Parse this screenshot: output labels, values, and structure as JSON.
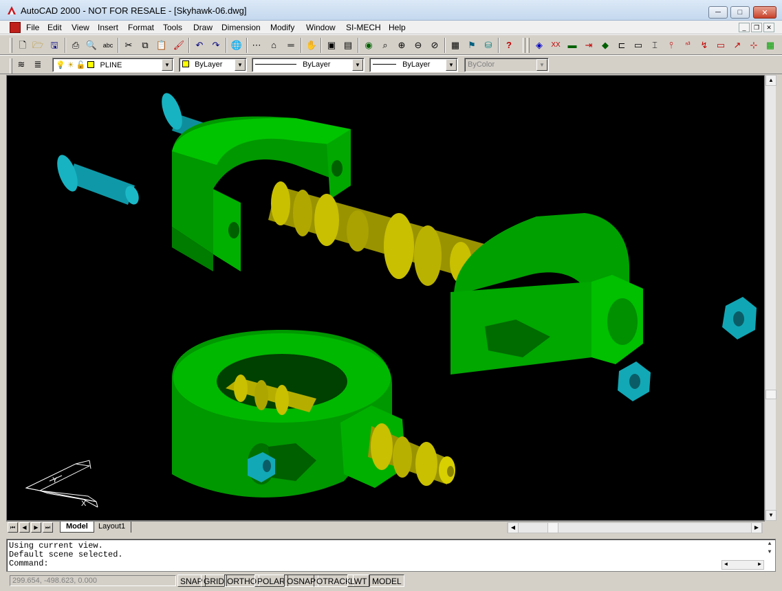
{
  "window": {
    "title": "AutoCAD 2000 - NOT FOR RESALE - [Skyhawk-06.dwg]",
    "controls": {
      "minimize": "─",
      "maximize": "□",
      "close": "✕"
    }
  },
  "menu": {
    "items": [
      "File",
      "Edit",
      "View",
      "Insert",
      "Format",
      "Tools",
      "Draw",
      "Dimension",
      "Modify",
      "Window",
      "SI-MECH",
      "Help"
    ]
  },
  "toolbar_standard": {
    "icons": [
      "new-icon",
      "open-icon",
      "save-icon",
      "print-icon",
      "print-preview-icon",
      "spell-icon",
      "cut-icon",
      "copy-icon",
      "paste-icon",
      "match-properties-icon",
      "undo-icon",
      "redo-icon",
      "hyperlink-icon",
      "tracking-icon",
      "ucs-icon",
      "distance-icon",
      "pan-icon",
      "named-views-icon",
      "3d-orbit-icon",
      "zoom-realtime-icon",
      "zoom-window-icon",
      "zoom-previous-icon",
      "properties-icon",
      "design-center-icon",
      "dbconnect-icon",
      "help-icon"
    ]
  },
  "toolbar_simech": {
    "icons": [
      "sm-block-icon",
      "sm-xx-icon",
      "sm-screen-icon",
      "sm-flip-icon",
      "sm-fastener-icon",
      "sm-bearing-icon",
      "sm-shaft-icon",
      "sm-beam-icon",
      "sm-spring-icon",
      "sm-balloon-icon",
      "sm-weld-icon",
      "sm-dim-icon",
      "sm-edit-icon",
      "sm-table-icon"
    ]
  },
  "layers_toolbar": {
    "layer_name": "PLINE",
    "color": "ByLayer",
    "linetype": "ByLayer",
    "lineweight": "ByLayer",
    "plotstyle": "ByColor"
  },
  "colors": {
    "green_part": "#00b000",
    "yellow_part": "#c8c000",
    "cyan_part": "#10a8b8",
    "viewport_bg": "#000000",
    "layer_swatch": "#ffff00"
  },
  "tabs": [
    "Model",
    "Layout1"
  ],
  "command_history": [
    "Using current view.",
    "Default scene selected."
  ],
  "command_prompt": "Command:",
  "status": {
    "coordinates": "299.654, -498.623, 0.000",
    "buttons": [
      "SNAP",
      "GRID",
      "ORTHO",
      "POLAR",
      "OSNAP",
      "OTRACK",
      "LWT",
      "MODEL"
    ]
  },
  "ucs_icon": {
    "x_label": "X",
    "y_label": "Y"
  }
}
